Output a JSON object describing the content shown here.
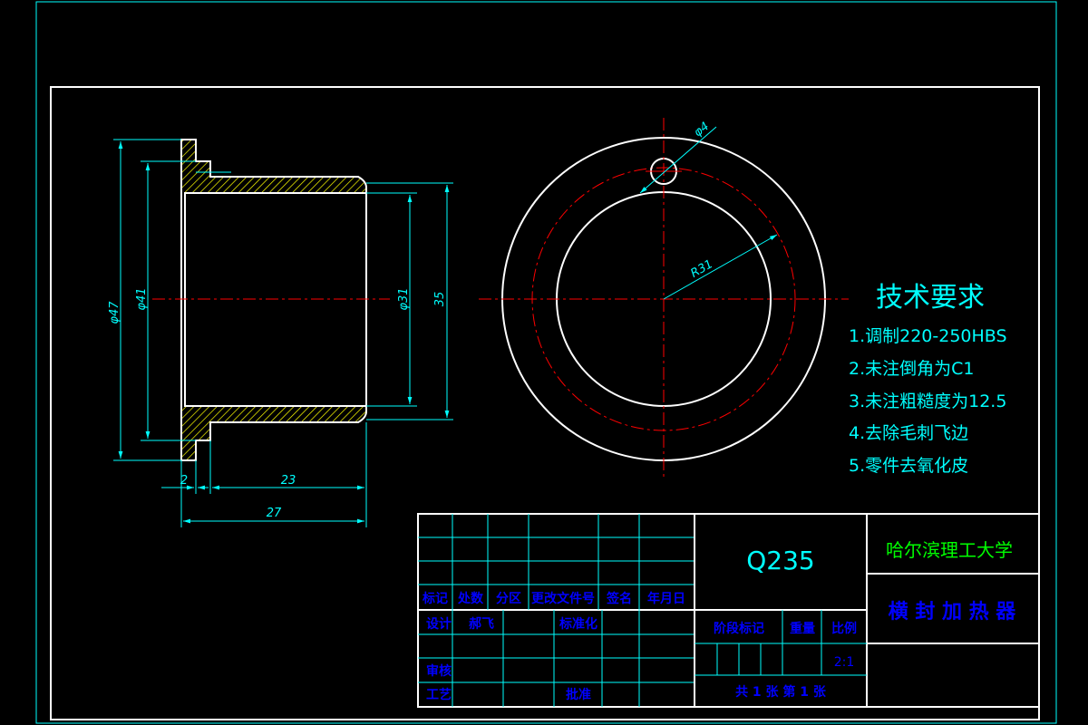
{
  "drawing": {
    "dimensions": {
      "d47": "φ47",
      "d41": "φ41",
      "d31": "φ31",
      "h35": "35",
      "w2": "2",
      "w23": "23",
      "w27": "27",
      "hole_d4": "φ4",
      "radius": "R31"
    },
    "requirements": {
      "title": "技术要求",
      "items": [
        "1.调制220-250HBS",
        "2.未注倒角为C1",
        "3.未注粗糙度为12.5",
        "4.去除毛刺飞边",
        "5.零件去氧化皮"
      ]
    }
  },
  "title_block": {
    "material": "Q235",
    "school": "哈尔滨理工大学",
    "part_name": "横 封 加 热 器",
    "header_labels": [
      "标记",
      "处数",
      "分区",
      "更改文件号",
      "签名",
      "年月日"
    ],
    "design_label": "设计",
    "designer": "郝飞",
    "standardization_label": "标准化",
    "review_label": "审核",
    "process_label": "工艺",
    "approve_label": "批准",
    "stage_label": "阶段标记",
    "weight_label": "重量",
    "scale_label": "比例",
    "scale_value": "2:1",
    "sheets_label": "共 1 张   第 1 张"
  },
  "colors": {
    "outline": "#ffffff",
    "border": "#00ffff",
    "center_line": "#ff0000",
    "hatch": "#ffff00",
    "dimension": "#00ffff",
    "school_text": "#00ff00",
    "title_label": "#0000ff"
  }
}
